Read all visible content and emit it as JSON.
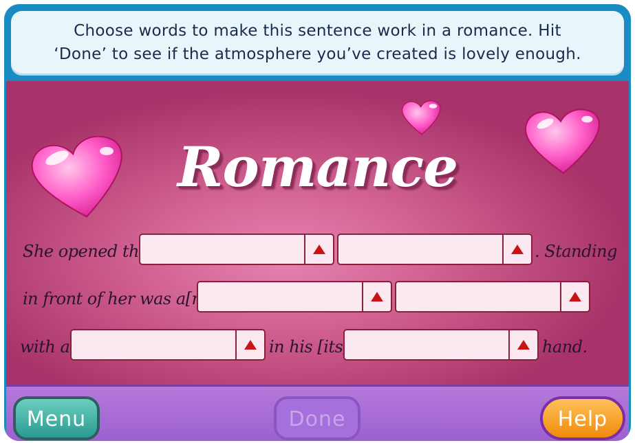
{
  "instructions": {
    "line1": "Choose words to make this sentence work in a romance. Hit",
    "line2": "‘Done’ to see if the atmosphere you’ve created is lovely enough."
  },
  "title": "Romance",
  "sentence": {
    "row1": {
      "t1": "She opened the",
      "t2": ". Standing"
    },
    "row2": {
      "t1": "in front of her was a[n]"
    },
    "row3": {
      "t1": "with a",
      "t2": "in his [its]",
      "t3": "hand."
    }
  },
  "dropdowns": {
    "selected": [
      "",
      "",
      "",
      "",
      "",
      ""
    ]
  },
  "buttons": {
    "menu": "Menu",
    "done": "Done",
    "help": "Help"
  },
  "colors": {
    "frame": "#1a8cc4",
    "stage": "#d0608f",
    "bottom_bar": "#a86ad6",
    "dropdown_border": "#8a1f3c",
    "arrow": "#c81414"
  },
  "icons": [
    "heart-icon",
    "up-arrow-icon"
  ]
}
